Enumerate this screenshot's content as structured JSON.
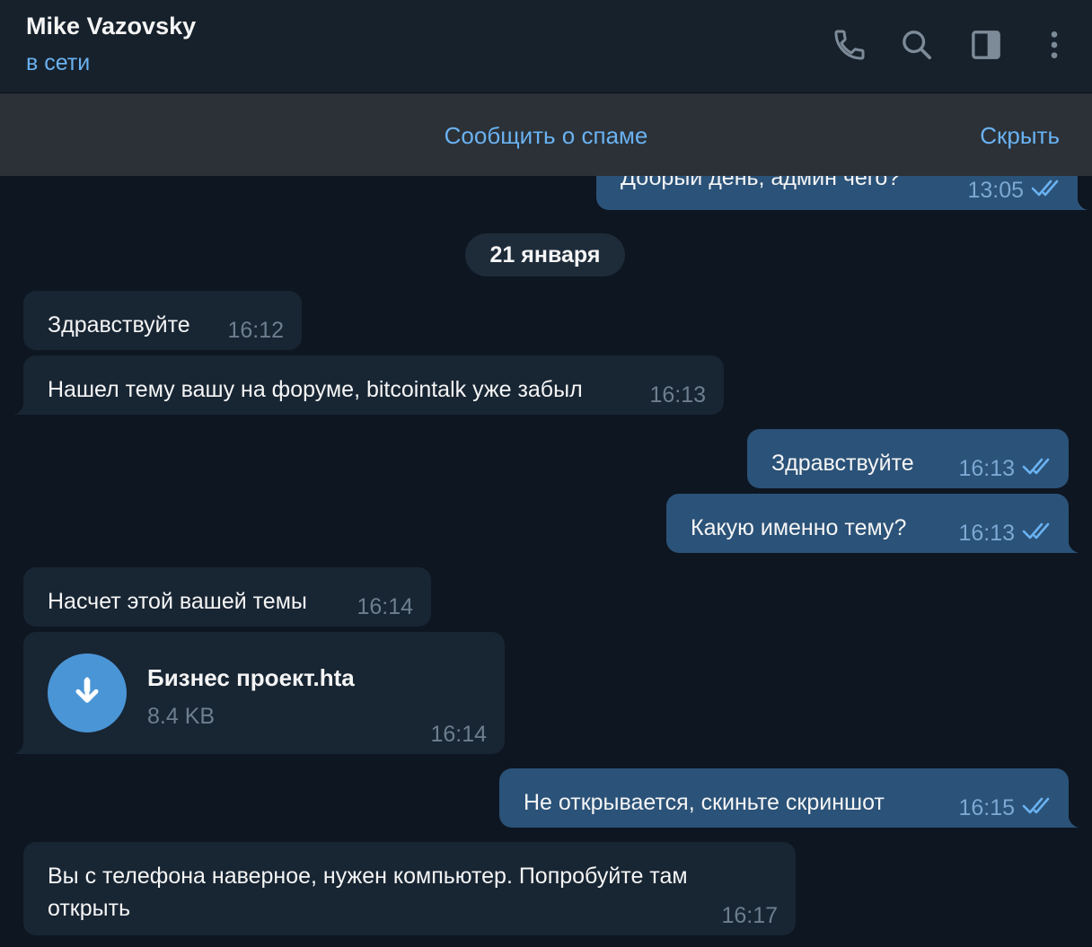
{
  "header": {
    "contact_name": "Mike Vazovsky",
    "status": "в сети",
    "icons": [
      "phone-icon",
      "search-icon",
      "sidebar-toggle-icon",
      "more-vertical-icon"
    ]
  },
  "spam_bar": {
    "report_label": "Сообщить о спаме",
    "hide_label": "Скрыть"
  },
  "colors": {
    "background": "#0e1621",
    "header": "#17212b",
    "incoming_bubble": "#182533",
    "outgoing_bubble": "#2b5278",
    "accent": "#6ab2f2",
    "file_icon": "#4a95d6"
  },
  "chat": {
    "date_separator": "21 января",
    "messages": [
      {
        "direction": "out",
        "text": "Добрый день, админ чего?",
        "time": "13:05",
        "read": true
      },
      {
        "direction": "in",
        "text": "Здравствуйте",
        "time": "16:12"
      },
      {
        "direction": "in",
        "text": "Нашел тему вашу на форуме, bitcointalk уже забыл",
        "time": "16:13"
      },
      {
        "direction": "out",
        "text": "Здравствуйте",
        "time": "16:13",
        "read": true
      },
      {
        "direction": "out",
        "text": "Какую именно тему?",
        "time": "16:13",
        "read": true
      },
      {
        "direction": "in",
        "text": "Насчет этой вашей темы",
        "time": "16:14"
      },
      {
        "direction": "in",
        "type": "file",
        "file_name": "Бизнес проект.hta",
        "file_size": "8.4 KB",
        "time": "16:14",
        "icon": "download-icon"
      },
      {
        "direction": "out",
        "text": "Не открывается, скиньте скриншот",
        "time": "16:15",
        "read": true
      },
      {
        "direction": "in",
        "text": "Вы с телефона наверное, нужен компьютер. Попробуйте там открыть",
        "time": "16:17"
      }
    ]
  }
}
